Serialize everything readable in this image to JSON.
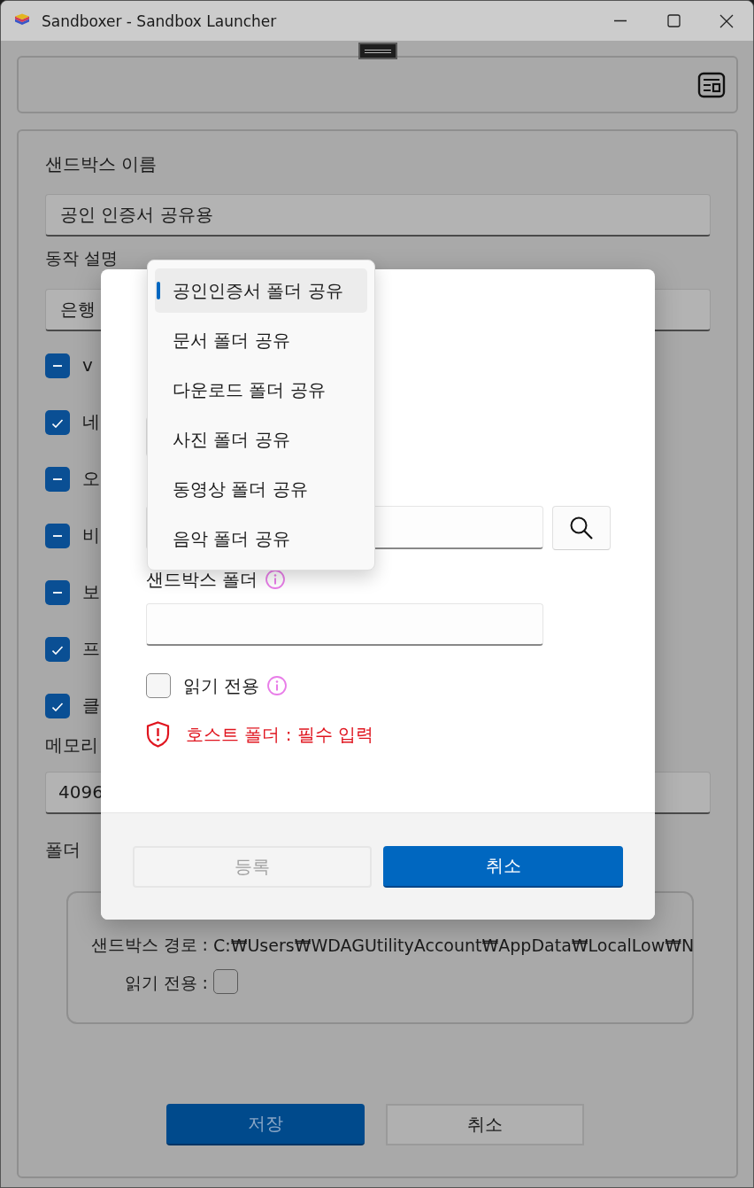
{
  "window": {
    "title": "Sandboxer - Sandbox Launcher"
  },
  "form": {
    "name_label": "샌드박스 이름",
    "name_value": "공인 인증서 공유용",
    "description_label": "동작 설명",
    "description_value": "은행",
    "options": [
      {
        "label": "v",
        "kind": "tristate",
        "checked": false
      },
      {
        "label": "네",
        "kind": "check",
        "checked": true
      },
      {
        "label": "오",
        "kind": "tristate",
        "checked": false
      },
      {
        "label": "비",
        "kind": "tristate",
        "checked": false
      },
      {
        "label": "보",
        "kind": "tristate",
        "checked": false
      },
      {
        "label": "프",
        "kind": "check",
        "checked": true
      },
      {
        "label": "클",
        "kind": "check",
        "checked": true
      }
    ],
    "memory_label": "메모리",
    "memory_value": "4096",
    "folder_label": "폴더",
    "folder_entry": {
      "sandbox_path_label": "샌드박스 경로 :",
      "sandbox_path": "C:₩Users₩WDAGUtilityAccount₩AppData₩LocalLow₩N",
      "read_only_label": "읽기 전용 :",
      "read_only": false
    },
    "buttons": [
      {
        "label": "저장",
        "kind": "primary"
      },
      {
        "label": "취소",
        "kind": "secondary"
      }
    ]
  },
  "dialog": {
    "sandbox_folder_label": "샌드박스 폴더",
    "read_only_label": "읽기 전용",
    "read_only": false,
    "error": "호스트 폴더 : 필수 입력",
    "buttons": [
      {
        "label": "등록",
        "kind": "disabled"
      },
      {
        "label": "취소",
        "kind": "accent"
      }
    ]
  },
  "dropdown": {
    "items": [
      {
        "label": "공인인증서 폴더 공유",
        "selected": true
      },
      {
        "label": "문서 폴더 공유",
        "selected": false
      },
      {
        "label": "다운로드 폴더 공유",
        "selected": false
      },
      {
        "label": "사진 폴더 공유",
        "selected": false
      },
      {
        "label": "동영상 폴더 공유",
        "selected": false
      },
      {
        "label": "음악 폴더 공유",
        "selected": false
      }
    ]
  }
}
